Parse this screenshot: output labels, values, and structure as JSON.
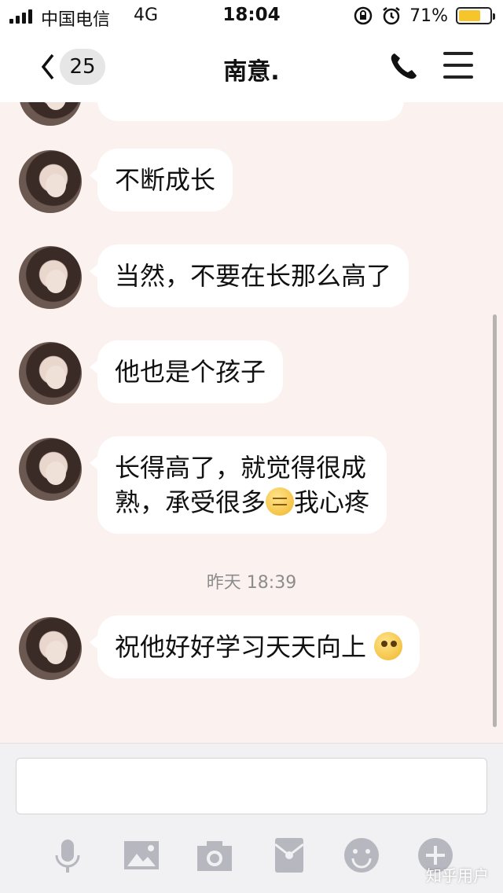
{
  "status_bar": {
    "carrier": "中国电信",
    "network": "4G",
    "time": "18:04",
    "battery": "71%"
  },
  "header": {
    "back_count": "25",
    "title": "南意."
  },
  "messages": [
    {
      "text": "不断成长"
    },
    {
      "text": "当然，不要在长那么高了"
    },
    {
      "text": "他也是个孩子"
    },
    {
      "line1": "长得高了，就觉得很成",
      "line2_a": "熟，承受很多",
      "line2_b": "我心疼",
      "emoji": "sad-emoji"
    },
    {
      "text": "祝他好好学习天天向上",
      "emoji": "cute-emoji"
    }
  ],
  "timestamp": "昨天 18:39",
  "input": {
    "value": "",
    "placeholder": ""
  },
  "toolbar": [
    "microphone-icon",
    "image-icon",
    "camera-icon",
    "red-packet-icon",
    "emoji-icon",
    "plus-icon"
  ],
  "watermark": "知乎用户",
  "colors": {
    "background": "#fbf2ef",
    "bubble": "#ffffff",
    "battery": "#f5c52b"
  }
}
